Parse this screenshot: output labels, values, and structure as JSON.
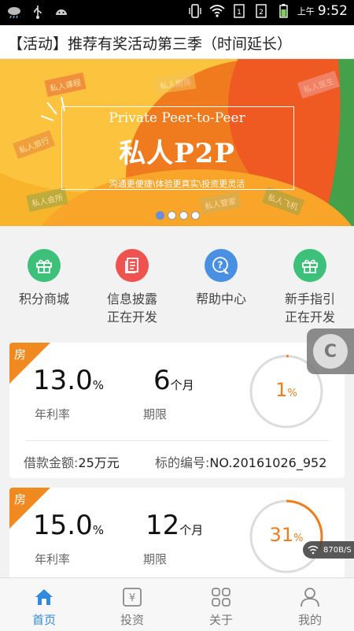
{
  "statusbar": {
    "ampm": "上午",
    "time": "9:52"
  },
  "notice": {
    "text": "【活动】推荐有奖活动第三季（时间延长）"
  },
  "banner": {
    "subtitle": "Private Peer-to-Peer",
    "title": "私人P2P",
    "tagline": "沟通更便捷\\体验更真实\\投资更灵活",
    "mini_tags": [
      "私人课程",
      "私人厨房",
      "私人医生",
      "私人旅行",
      "私人会所",
      "私人管家",
      "私人飞机"
    ],
    "page_count": 4,
    "active_page": 0
  },
  "menu": [
    {
      "line1": "积分商城",
      "line2": "",
      "color": "#3cc07a",
      "icon": "gift-icon"
    },
    {
      "line1": "信息披露",
      "line2": "正在开发",
      "color": "#ef5350",
      "icon": "document-icon"
    },
    {
      "line1": "帮助中心",
      "line2": "",
      "color": "#4a90e2",
      "icon": "help-icon"
    },
    {
      "line1": "新手指引",
      "line2": "正在开发",
      "color": "#3cc07a",
      "icon": "gift-icon"
    }
  ],
  "loans": [
    {
      "tag": "房",
      "rate": "13.0",
      "rate_unit": "%",
      "rate_label": "年利率",
      "term": "6",
      "term_unit": "个月",
      "term_label": "期限",
      "progress_text": "1",
      "progress_unit": "%",
      "progress": 0.01,
      "amount_label": "借款金额:",
      "amount": "25万元",
      "id_label": "标的编号:",
      "id": "NO.20161026_952"
    },
    {
      "tag": "房",
      "rate": "15.0",
      "rate_unit": "%",
      "rate_label": "年利率",
      "term": "12",
      "term_unit": "个月",
      "term_label": "期限",
      "progress_text": "31",
      "progress_unit": "%",
      "progress": 0.31
    }
  ],
  "overlays": {
    "speed": "870B/S",
    "float_letter": "C"
  },
  "tabs": [
    {
      "label": "首页",
      "icon": "home-icon"
    },
    {
      "label": "投资",
      "icon": "yuan-icon"
    },
    {
      "label": "关于",
      "icon": "grid-icon"
    },
    {
      "label": "我的",
      "icon": "user-icon"
    }
  ],
  "colors": {
    "accent": "#2f8ae0",
    "orange": "#f07d1a"
  }
}
